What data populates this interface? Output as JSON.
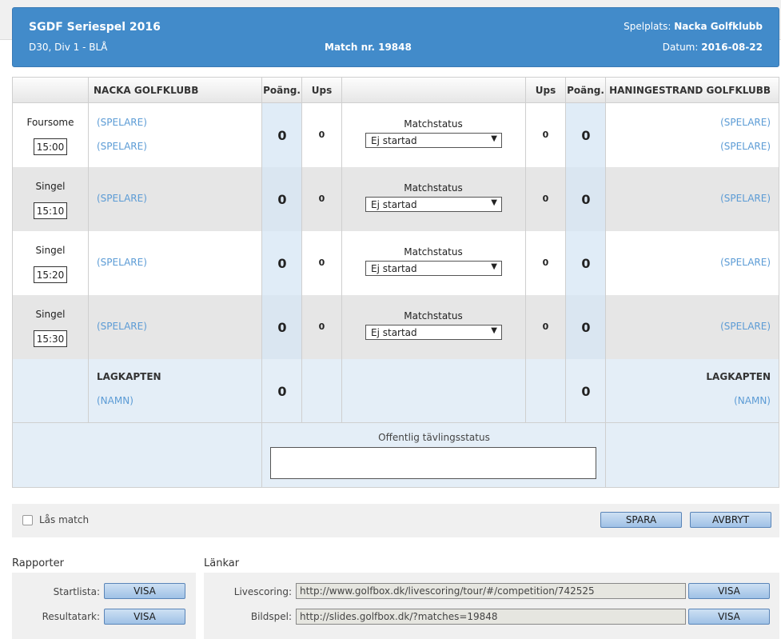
{
  "header": {
    "title": "SGDF Seriespel 2016",
    "division": "D30, Div 1 - BLÅ",
    "match_label": "Match nr. 19848",
    "venue_label": "Spelplats:",
    "venue": "Nacka Golfklubb",
    "date_label": "Datum:",
    "date": "2016-08-22"
  },
  "table": {
    "home_team": "NACKA GOLFKLUBB",
    "away_team": "HANINGESTRAND GOLFKLUBB",
    "points_header": "Poäng.",
    "ups_header": "Ups",
    "matchstatus_label": "Matchstatus",
    "rows": [
      {
        "type": "Foursome",
        "time": "15:00",
        "home_players": [
          "(SPELARE)",
          "(SPELARE)"
        ],
        "away_players": [
          "(SPELARE)",
          "(SPELARE)"
        ],
        "home_points": "0",
        "home_ups": "0",
        "away_ups": "0",
        "away_points": "0",
        "status": "Ej startad"
      },
      {
        "type": "Singel",
        "time": "15:10",
        "home_players": [
          "(SPELARE)"
        ],
        "away_players": [
          "(SPELARE)"
        ],
        "home_points": "0",
        "home_ups": "0",
        "away_ups": "0",
        "away_points": "0",
        "status": "Ej startad"
      },
      {
        "type": "Singel",
        "time": "15:20",
        "home_players": [
          "(SPELARE)"
        ],
        "away_players": [
          "(SPELARE)"
        ],
        "home_points": "0",
        "home_ups": "0",
        "away_ups": "0",
        "away_points": "0",
        "status": "Ej startad"
      },
      {
        "type": "Singel",
        "time": "15:30",
        "home_players": [
          "(SPELARE)"
        ],
        "away_players": [
          "(SPELARE)"
        ],
        "home_points": "0",
        "home_ups": "0",
        "away_ups": "0",
        "away_points": "0",
        "status": "Ej startad"
      }
    ],
    "captain": {
      "label": "LAGKAPTEN",
      "home_name": "(NAMN)",
      "away_name": "(NAMN)",
      "home_points": "0",
      "away_points": "0"
    },
    "public_status_label": "Offentlig tävlingsstatus",
    "public_status_value": ""
  },
  "actions": {
    "lock_label": "Lås match",
    "lock_checked": false,
    "save_label": "SPARA",
    "cancel_label": "AVBRYT"
  },
  "reports": {
    "title": "Rapporter",
    "items": [
      {
        "label": "Startlista:",
        "button": "VISA"
      },
      {
        "label": "Resultatark:",
        "button": "VISA"
      }
    ]
  },
  "links": {
    "title": "Länkar",
    "items": [
      {
        "label": "Livescoring:",
        "url": "http://www.golfbox.dk/livescoring/tour/#/competition/742525",
        "button": "VISA"
      },
      {
        "label": "Bildspel:",
        "url": "http://slides.golfbox.dk/?matches=19848",
        "button": "VISA"
      }
    ]
  },
  "colors": {
    "header_bg": "#428bca",
    "link": "#5b9bd5",
    "button_bg": "#9fc1e6"
  }
}
